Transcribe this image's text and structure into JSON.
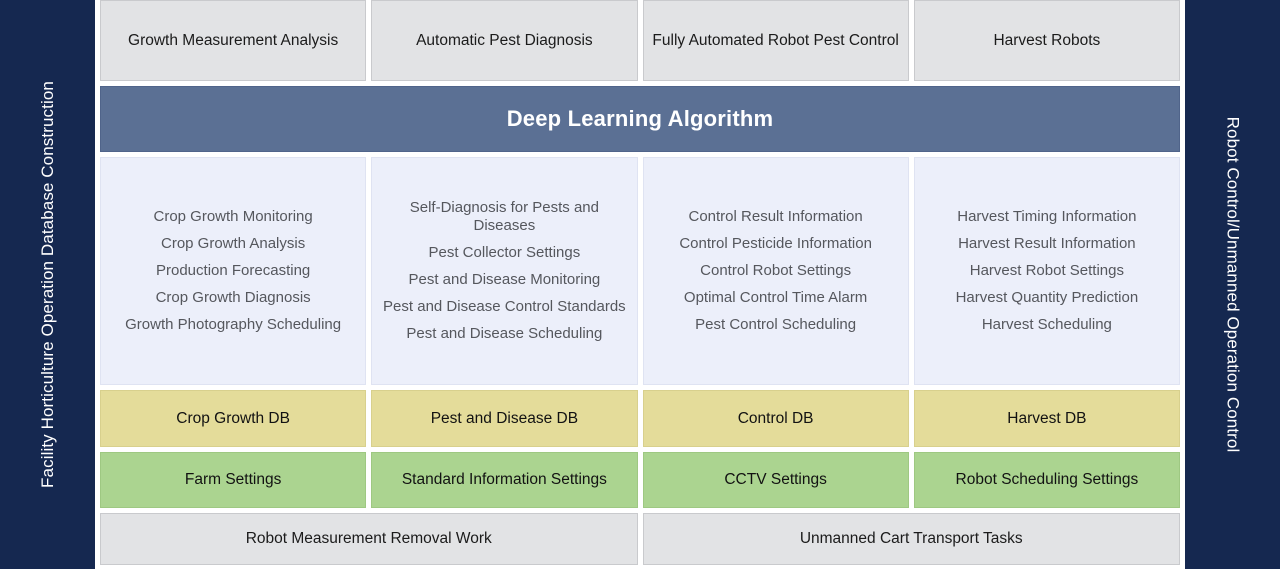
{
  "rails": {
    "left": {
      "label": "Facility Horticulture Operation Database Construction",
      "color": "#152850"
    },
    "right": {
      "label": "Robot Control/Unmanned Operation Control",
      "color": "#152850"
    }
  },
  "banner": {
    "label": "Deep Learning Algorithm",
    "color": "#5b7094"
  },
  "colors": {
    "app_card": "#e2e3e5",
    "function_panel": "#eceffa",
    "database_card": "#e4dc9a",
    "settings_card": "#abd490",
    "task_card": "#e2e3e5",
    "rail": "#152850",
    "banner": "#5b7094"
  },
  "applications": [
    {
      "label": "Growth Measurement Analysis"
    },
    {
      "label": "Automatic Pest Diagnosis"
    },
    {
      "label": "Fully Automated Robot Pest Control"
    },
    {
      "label": "Harvest Robots"
    }
  ],
  "functions": [
    {
      "items": [
        "Crop Growth Monitoring",
        "Crop Growth Analysis",
        "Production Forecasting",
        "Crop Growth Diagnosis",
        "Growth Photography Scheduling"
      ]
    },
    {
      "items": [
        "Self-Diagnosis for Pests and Diseases",
        "Pest Collector Settings",
        "Pest and Disease Monitoring",
        "Pest and Disease Control Standards",
        "Pest and Disease Scheduling"
      ]
    },
    {
      "items": [
        "Control Result Information",
        "Control Pesticide Information",
        "Control Robot Settings",
        "Optimal Control Time Alarm",
        "Pest Control Scheduling"
      ]
    },
    {
      "items": [
        "Harvest Timing Information",
        "Harvest Result Information",
        "Harvest Robot Settings",
        "Harvest Quantity Prediction",
        "Harvest Scheduling"
      ]
    }
  ],
  "databases": [
    {
      "label": "Crop Growth DB"
    },
    {
      "label": "Pest and Disease DB"
    },
    {
      "label": "Control DB"
    },
    {
      "label": "Harvest DB"
    }
  ],
  "settings": [
    {
      "label": "Farm Settings"
    },
    {
      "label": "Standard Information Settings"
    },
    {
      "label": "CCTV Settings"
    },
    {
      "label": "Robot Scheduling Settings"
    }
  ],
  "tasks": [
    {
      "label": "Robot Measurement Removal Work"
    },
    {
      "label": "Unmanned Cart Transport Tasks"
    }
  ]
}
